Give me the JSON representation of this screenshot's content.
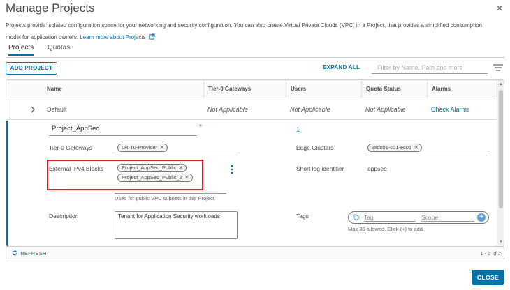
{
  "dialog": {
    "title": "Manage Projects",
    "intro_text": "Projects provide isolated configuration space for your networking and security configuration. You can also create Virtual Private Clouds (VPC) in a Project, that provides a simplified consumption model for application owners.",
    "learn_more_link": "Learn more about Projects",
    "close_label": "CLOSE"
  },
  "tabs": [
    {
      "label": "Projects",
      "active": true
    },
    {
      "label": "Quotas",
      "active": false
    }
  ],
  "toolbar": {
    "add_project_label": "ADD PROJECT",
    "expand_all_label": "EXPAND ALL",
    "filter_placeholder": "Filter by Name, Path and more"
  },
  "table": {
    "columns": [
      "Name",
      "Tier-0 Gateways",
      "Users",
      "Quota Status",
      "Alarms"
    ],
    "rows": [
      {
        "name": "Default",
        "tier0": "Not Applicable",
        "users": "Not Applicable",
        "quota_status": "Not Applicable",
        "alarms": "Check Alarms"
      }
    ],
    "expanded_row": {
      "name_value": "Project_AppSec",
      "users_count": "1",
      "tier0_label": "Tier-0 Gateways",
      "tier0_chips": [
        "LR-T0-Provider"
      ],
      "edge_clusters_label": "Edge Clusters",
      "edge_clusters_chips": [
        "vxdc01-c01-ec01"
      ],
      "ipv4_label": "External IPv4 Blocks",
      "ipv4_chips": [
        "Project_AppSec_Public",
        "Project_AppSec_Public_2"
      ],
      "ipv4_helper": "Used for public VPC subnets in this Project",
      "short_log_label": "Short log identifier",
      "short_log_value": "appsec",
      "description_label": "Description",
      "description_value": "Tenant for Application Security workloads",
      "tags_label": "Tags",
      "tag_placeholder": "Tag",
      "scope_placeholder": "Scope",
      "tags_helper": "Max 30 allowed. Click (+) to add."
    }
  },
  "footer": {
    "refresh_label": "REFRESH",
    "page_count": "1 - 2 of 2"
  },
  "colors": {
    "accent": "#0072a3",
    "highlight": "#e02020",
    "required": "#c92100"
  }
}
